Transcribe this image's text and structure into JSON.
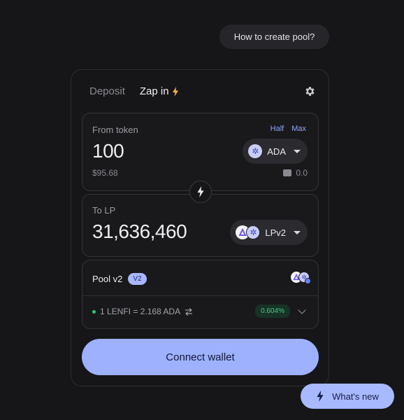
{
  "help": {
    "label": "How to create pool?"
  },
  "tabs": [
    {
      "label": "Deposit",
      "active": false
    },
    {
      "label": "Zap in",
      "active": true
    }
  ],
  "icons": {
    "zap": "lightning-icon",
    "settings": "gear-icon",
    "swap": "lightning-icon",
    "wallet": "wallet-icon",
    "dropdown": "chevron-down-icon"
  },
  "from": {
    "label": "From token",
    "half": "Half",
    "max": "Max",
    "amount": "100",
    "usd": "$95.68",
    "token": "ADA",
    "balance": "0.0"
  },
  "to": {
    "label": "To LP",
    "amount": "31,636,460",
    "token": "LPv2"
  },
  "pool": {
    "title": "Pool v2",
    "badge": "V2",
    "rate": "1 LENFI = 2.168 ADA",
    "apr": "0.604%"
  },
  "connect_label": "Connect wallet",
  "whats_new_label": "What's new",
  "colors": {
    "accent": "#9db1ff",
    "positive": "#3fd08a",
    "background": "#161618"
  }
}
